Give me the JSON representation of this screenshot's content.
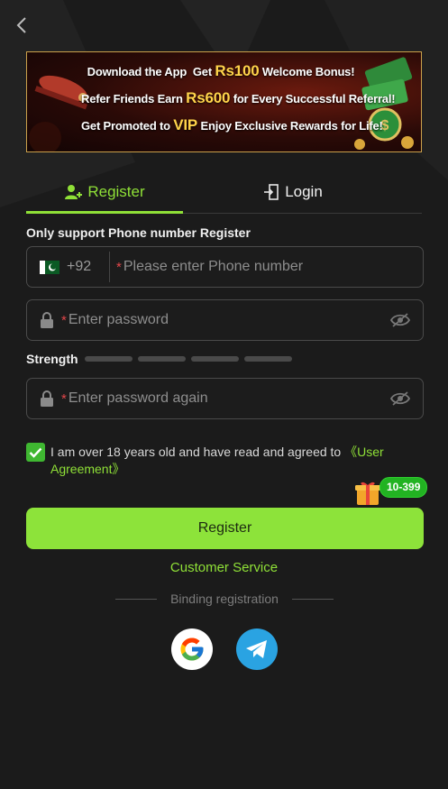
{
  "banner": {
    "line1_a": "Download the App",
    "line1_b": "Get",
    "line1_amount": "Rs100",
    "line1_c": "Welcome Bonus!",
    "line2_a": "Refer Friends",
    "line2_b": "Earn",
    "line2_amount": "Rs600",
    "line2_c": "for Every Successful Referral!",
    "line3_a": "Get Promoted to",
    "line3_vip": "VIP",
    "line3_c": "Enjoy Exclusive Rewards for Life!"
  },
  "tabs": {
    "register": "Register",
    "login": "Login"
  },
  "form": {
    "note": "Only support Phone number Register",
    "country_code": "+92",
    "required_mark": "*",
    "phone_placeholder": "Please enter Phone number",
    "password_placeholder": "Enter password",
    "strength_label": "Strength",
    "strength_level": 0,
    "confirm_placeholder": "Enter password again",
    "agree_checked": true,
    "agree_text": "I am over 18 years old and have read and agreed to ",
    "agree_link": "《User Agreement》",
    "register_button": "Register"
  },
  "promo_badge": "10-399",
  "customer_service": "Customer Service",
  "binding": {
    "label": "Binding registration",
    "providers": [
      "Google",
      "Telegram"
    ]
  },
  "colors": {
    "accent": "#8de33a",
    "background": "#1b1b1b",
    "required": "#e3464a"
  },
  "icons": [
    "back-arrow-icon",
    "user-add-icon",
    "login-icon",
    "pakistan-flag-icon",
    "lock-icon",
    "eye-off-icon",
    "checkmark-icon",
    "gift-icon",
    "google-icon",
    "telegram-icon"
  ]
}
